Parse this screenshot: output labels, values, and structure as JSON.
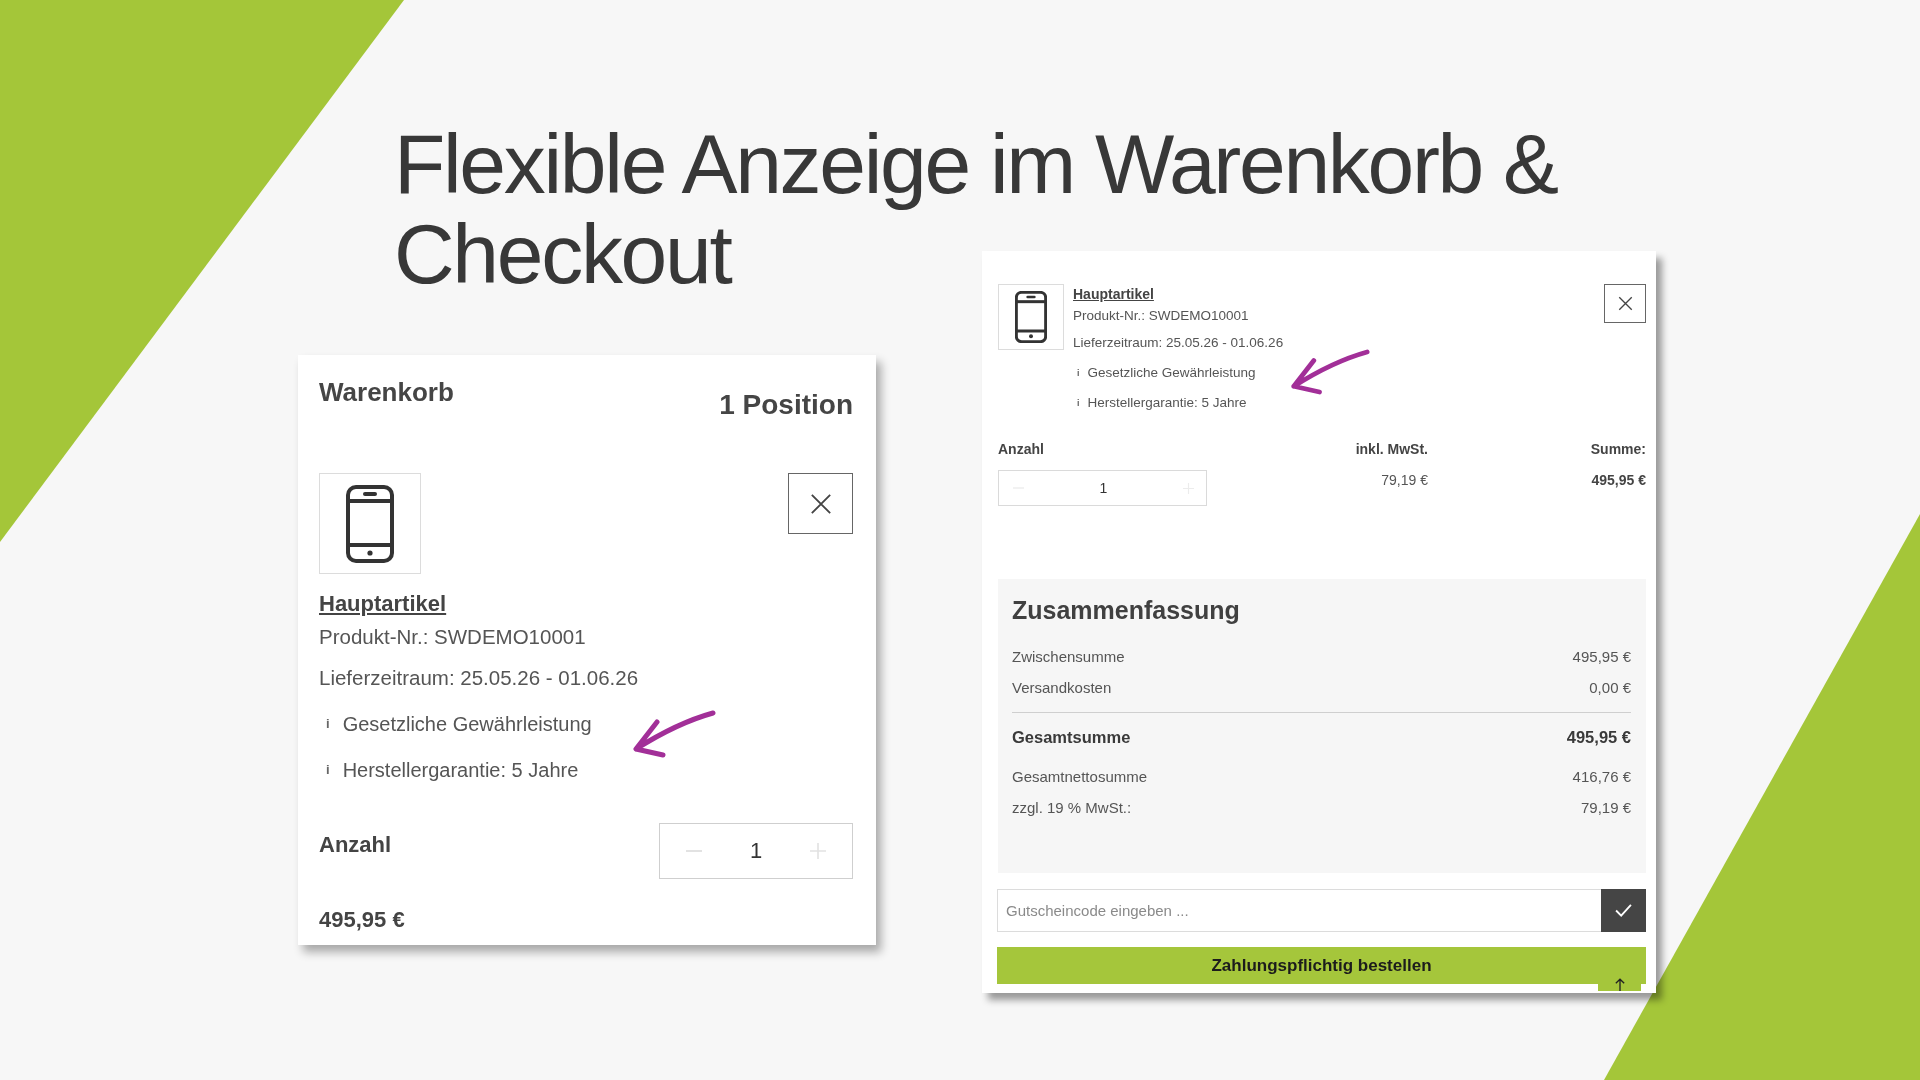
{
  "slide": {
    "title_lines": [
      "Flexible Anzeige im Warenkorb &",
      "Checkout"
    ]
  },
  "cart": {
    "title": "Warenkorb",
    "position_count": "1 Position",
    "item": {
      "name": "Hauptartikel",
      "details": [
        "Produkt-Nr.: SWDEMO10001",
        "Lieferzeitraum: 25.05.26 - 01.06.26"
      ],
      "info": [
        {
          "marker": "i",
          "text": "Gesetzliche Gewährleistung"
        },
        {
          "marker": "i",
          "text": "Herstellergarantie: 5 Jahre"
        }
      ]
    },
    "quantity_label": "Anzahl",
    "quantity": "1",
    "price": "495,95 €"
  },
  "checkout": {
    "item": {
      "name": "Hauptartikel",
      "details": [
        "Produkt-Nr.: SWDEMO10001",
        "Lieferzeitraum: 25.05.26 - 01.06.26"
      ],
      "info": [
        {
          "marker": "i",
          "text": "Gesetzliche Gewährleistung"
        },
        {
          "marker": "i",
          "text": "Herstellergarantie: 5 Jahre"
        }
      ]
    },
    "columns": [
      "Anzahl",
      "inkl. MwSt.",
      "Summe:"
    ],
    "quantity": "1",
    "tax": "79,19 €",
    "total": "495,95 €",
    "summary": {
      "title": "Zusammenfassung",
      "rows": [
        {
          "kind": "line",
          "label": "Zwischensumme",
          "value": "495,95 €"
        },
        {
          "kind": "line",
          "label": "Versandkosten",
          "value": "0,00 €"
        },
        {
          "kind": "total",
          "label": "Gesamtsumme",
          "value": "495,95 €"
        },
        {
          "kind": "line",
          "label": "Gesamtnettosumme",
          "value": "416,76 €"
        },
        {
          "kind": "line",
          "label": "zzgl. 19 % MwSt.:",
          "value": "79,19 €"
        }
      ]
    },
    "voucher": {
      "placeholder": "Gutscheincode eingeben ..."
    },
    "order_button": "Zahlungspflichtig bestellen"
  }
}
